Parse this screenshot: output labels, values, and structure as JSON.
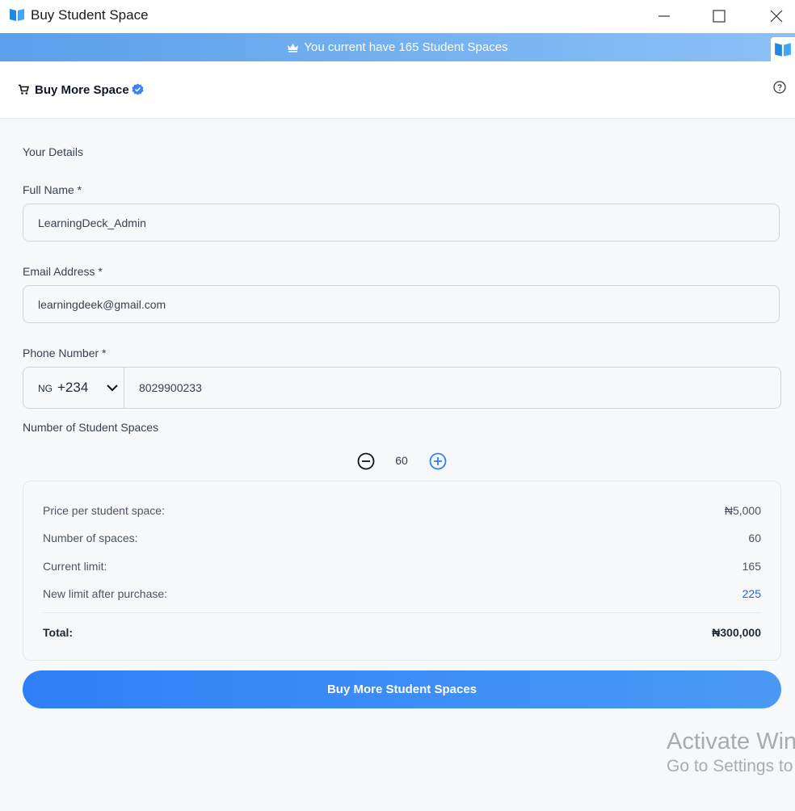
{
  "window": {
    "title": "Buy Student Space",
    "icon": "book-icon",
    "controls": [
      "minimize-icon",
      "maximize-icon",
      "close-icon"
    ]
  },
  "banner": {
    "icon": "crown-icon",
    "text": "You current have 165 Student Spaces",
    "colors": {
      "start": "#5aa0eb",
      "end": "#8cc1f6"
    }
  },
  "header": {
    "title": "Buy More Space",
    "title_icon": "cart-icon",
    "badge_icon": "verified-badge-icon",
    "help_icon": "help-icon"
  },
  "form": {
    "section_title": "Your Details",
    "full_name_label": "Full Name *",
    "full_name_value": "LearningDeck_Admin",
    "email_label": "Email Address *",
    "email_value": "learningdeek@gmail.com",
    "phone_label": "Phone Number *",
    "phone_country_code": "NG",
    "phone_dial_code": "+234",
    "phone_value": "8029900233",
    "spaces_label": "Number of Student Spaces",
    "spaces_value": "60"
  },
  "summary": {
    "price_label": "Price per student space:",
    "price_value": "₦5,000",
    "spaces_label": "Number of spaces:",
    "spaces_value": "60",
    "current_label": "Current limit:",
    "current_value": "165",
    "new_label": "New limit after purchase:",
    "new_value": "225",
    "total_label": "Total:",
    "total_value": "₦300,000"
  },
  "action": {
    "buy_label": "Buy More Student Spaces"
  },
  "watermark": {
    "line1": "Activate Win",
    "line2": "Go to Settings to"
  },
  "colors": {
    "accent": "#2f80f6",
    "accent_text": "#2563eb",
    "background": "#f7f8fa"
  }
}
